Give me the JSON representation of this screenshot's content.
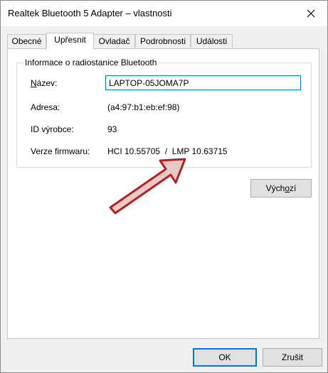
{
  "window": {
    "title": "Realtek Bluetooth 5 Adapter – vlastnosti"
  },
  "tabs": [
    {
      "label": "Obecné",
      "active": false
    },
    {
      "label": "Upřesnit",
      "active": true
    },
    {
      "label": "Ovladač",
      "active": false
    },
    {
      "label": "Podrobnosti",
      "active": false
    },
    {
      "label": "Události",
      "active": false
    }
  ],
  "group": {
    "title": "Informace o radiostanice Bluetooth",
    "name_label_first": "N",
    "name_label_rest": "ázev:",
    "name_value": "LAPTOP-05JOMA7P",
    "address_label": "Adresa:",
    "address_value": "(a4:97:b1:eb:ef:98)",
    "manufacturer_label": "ID výrobce:",
    "manufacturer_value": "93",
    "firmware_label": "Verze firmwaru:",
    "firmware_value": "HCI 10.55705  /  LMP 10.63715"
  },
  "buttons": {
    "default_label_before": "Vých",
    "default_label_ul": "o",
    "default_label_after": "zí",
    "ok_label": "OK",
    "cancel_label": "Zrušit"
  },
  "colors": {
    "arrow_fill": "#e8c9c9",
    "arrow_stroke": "#b22222",
    "focus_border": "#0078d7"
  },
  "icons": {
    "close": "close-icon",
    "annotation": "arrow-icon"
  }
}
